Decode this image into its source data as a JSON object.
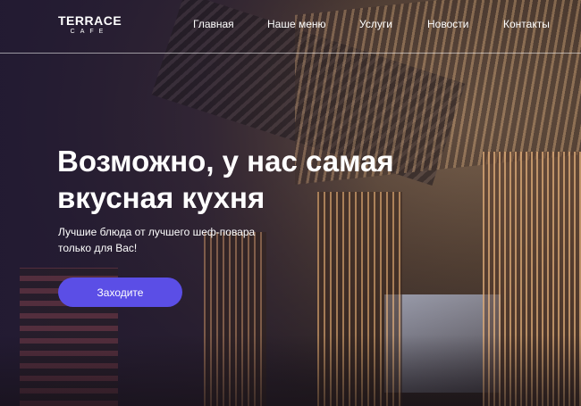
{
  "logo": {
    "main": "TERRACE",
    "sub": "CAFE"
  },
  "nav": {
    "items": [
      {
        "label": "Главная"
      },
      {
        "label": "Наше меню"
      },
      {
        "label": "Услуги"
      },
      {
        "label": "Новости"
      },
      {
        "label": "Контакты"
      }
    ]
  },
  "hero": {
    "title_line1": "Возможно, у нас самая",
    "title_line2": "вкусная кухня",
    "subtitle_line1": "Лучшие блюда от лучшего шеф-повара",
    "subtitle_line2": "только для Вас!",
    "cta_label": "Заходите"
  },
  "colors": {
    "accent": "#5b4ee6",
    "text": "#ffffff"
  }
}
